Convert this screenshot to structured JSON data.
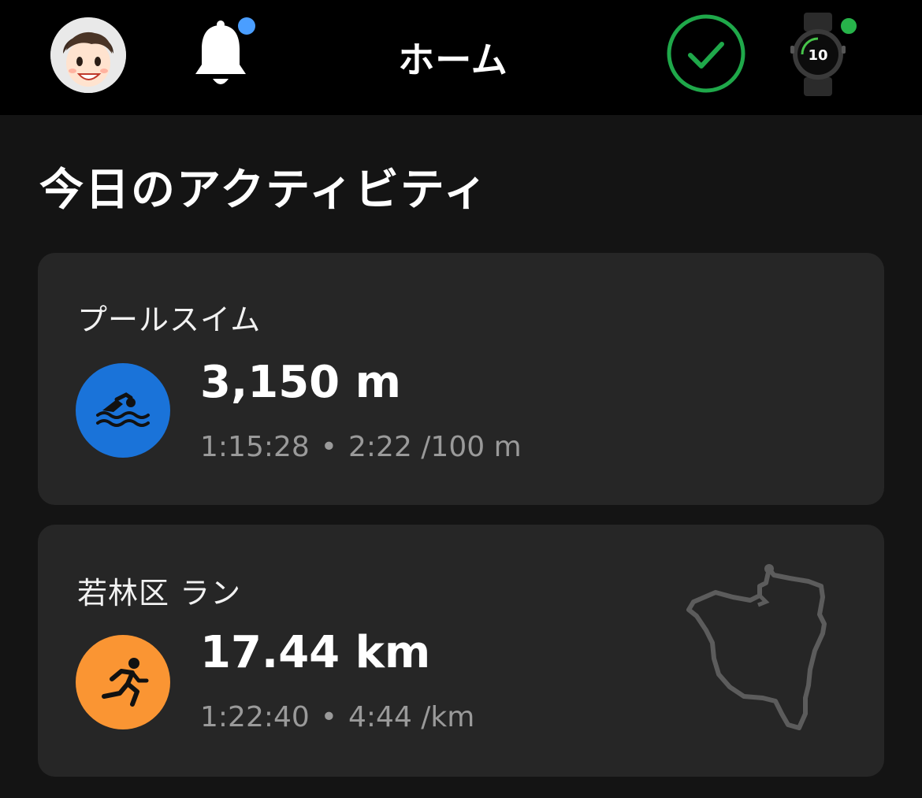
{
  "header": {
    "title": "ホーム",
    "avatar": "avatar",
    "bell_icon": "bell-icon",
    "sync_icon": "check-circle-icon",
    "device_icon": "watch-icon",
    "colors": {
      "bell_dot": "#4a9eff",
      "device_dot": "#27b34a",
      "check": "#1fa84a"
    }
  },
  "section": {
    "title": "今日のアクティビティ"
  },
  "activities": [
    {
      "label": "プールスイム",
      "icon": "swim-icon",
      "distance": "3,150 m",
      "duration": "1:15:28",
      "pace": "2:22 /100 m",
      "color": "#1a73d9"
    },
    {
      "label": "若林区 ラン",
      "icon": "run-icon",
      "distance": "17.44 km",
      "duration": "1:22:40",
      "pace": "4:44 /km",
      "color": "#fa9533",
      "route": "route-map"
    }
  ],
  "separator": "•"
}
